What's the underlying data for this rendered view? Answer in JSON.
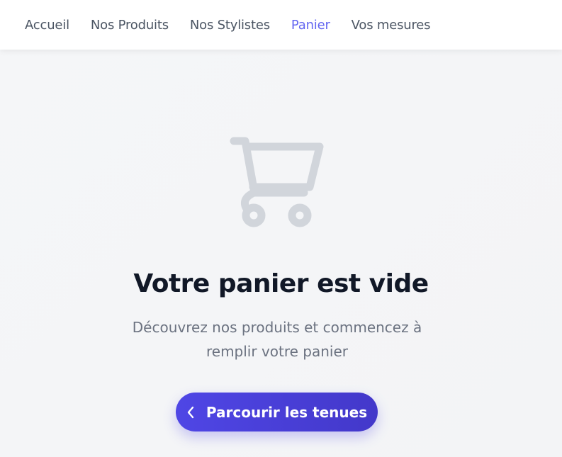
{
  "nav": {
    "items": [
      {
        "label": "Accueil",
        "active": false
      },
      {
        "label": "Nos Produits",
        "active": false
      },
      {
        "label": "Nos Stylistes",
        "active": false
      },
      {
        "label": "Panier",
        "active": true
      },
      {
        "label": "Vos mesures",
        "active": false
      }
    ]
  },
  "empty_cart": {
    "icon": "shopping-cart-icon",
    "title": "Votre panier est vide",
    "subtitle": "Découvrez nos produits et commencez à remplir votre panier",
    "cta_label": "Parcourir les tenues",
    "cta_icon": "chevron-left-icon"
  },
  "colors": {
    "accent": "#6366f1",
    "button": "#4f46e5",
    "icon": "#d1d5db",
    "title": "#111827",
    "text": "#6b7280"
  }
}
